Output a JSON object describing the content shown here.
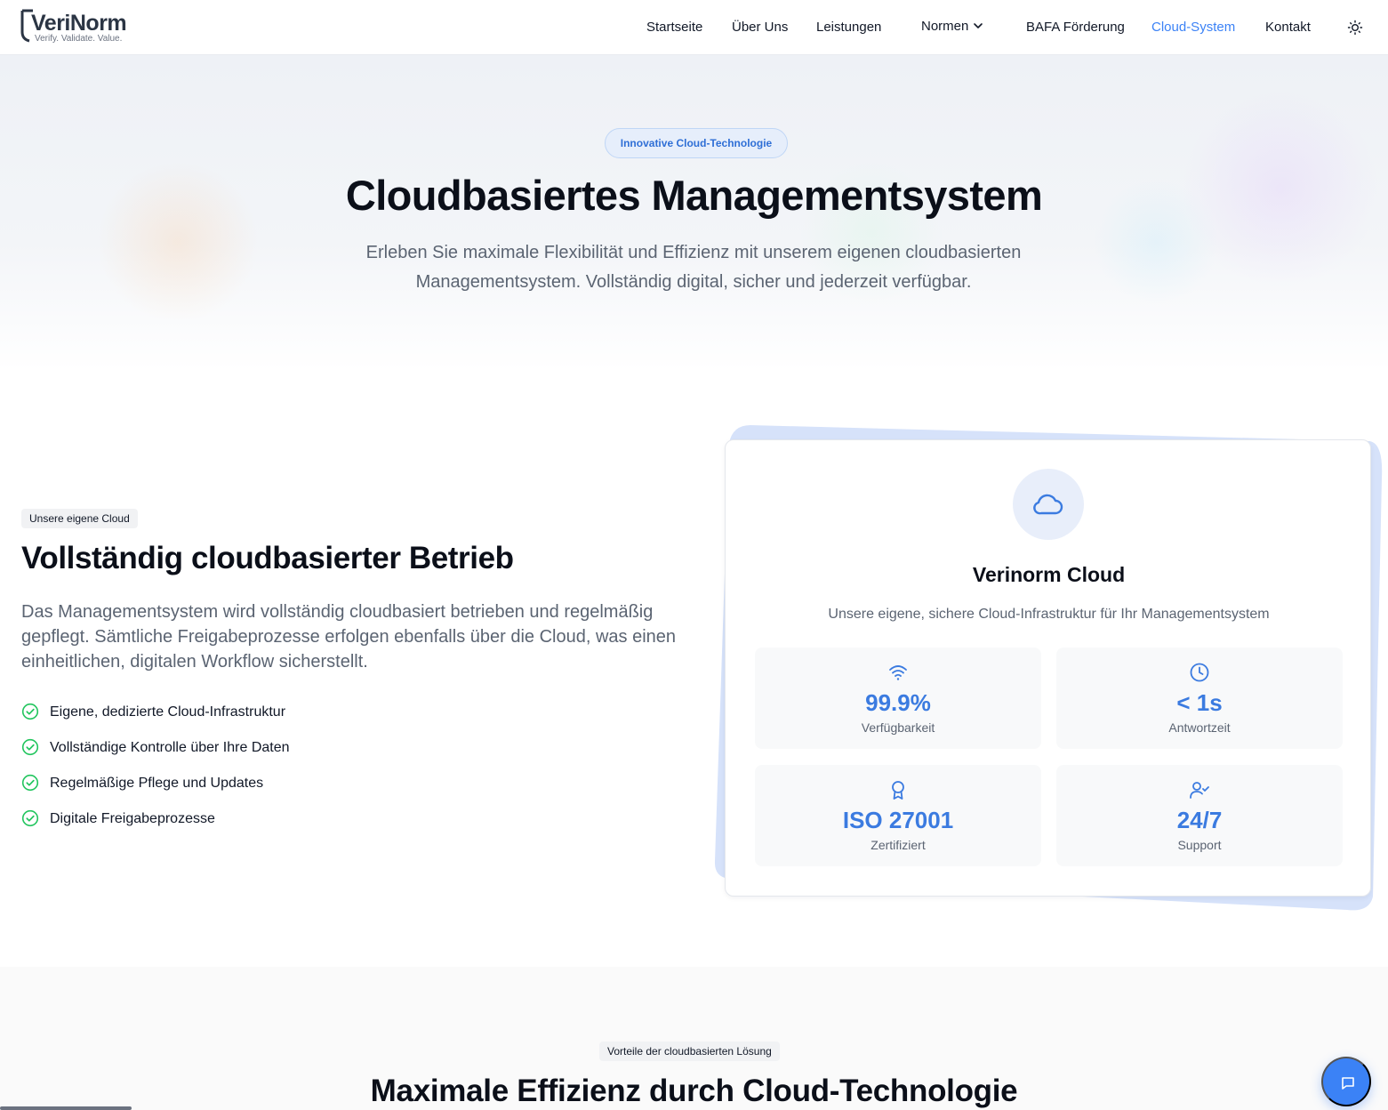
{
  "brand": {
    "name": "VeriNorm",
    "tagline": "Verify. Validate. Value."
  },
  "nav": {
    "items": [
      {
        "label": "Startseite"
      },
      {
        "label": "Über Uns"
      },
      {
        "label": "Leistungen"
      },
      {
        "label": "Normen"
      },
      {
        "label": "BAFA Förderung"
      },
      {
        "label": "Cloud-System",
        "active": true
      },
      {
        "label": "Kontakt"
      }
    ]
  },
  "hero": {
    "pill": "Innovative Cloud-Technologie",
    "title": "Cloudbasiertes Managementsystem",
    "subtitle": "Erleben Sie maximale Flexibilität und Effizienz mit unserem eigenen cloudbasierten Managementsystem. Vollständig digital, sicher und jederzeit verfügbar."
  },
  "feature": {
    "tag": "Unsere eigene Cloud",
    "title": "Vollständig cloudbasierter Betrieb",
    "description": "Das Managementsystem wird vollständig cloudbasiert betrieben und regelmäßig gepflegt. Sämtliche Freigabeprozesse erfolgen ebenfalls über die Cloud, was einen einheitlichen, digitalen Workflow sicherstellt.",
    "checks": [
      "Eigene, dedizierte Cloud-Infrastruktur",
      "Vollständige Kontrolle über Ihre Daten",
      "Regelmäßige Pflege und Updates",
      "Digitale Freigabeprozesse"
    ]
  },
  "card": {
    "icon": "cloud-icon",
    "title": "Verinorm Cloud",
    "subtitle": "Unsere eigene, sichere Cloud-Infrastruktur für Ihr Managementsystem",
    "stats": [
      {
        "icon": "wifi-icon",
        "value": "99.9%",
        "label": "Verfügbarkeit"
      },
      {
        "icon": "clock-icon",
        "value": "< 1s",
        "label": "Antwortzeit"
      },
      {
        "icon": "award-icon",
        "value": "ISO 27001",
        "label": "Zertifiziert"
      },
      {
        "icon": "user-check-icon",
        "value": "24/7",
        "label": "Support"
      }
    ]
  },
  "benefits": {
    "tag": "Vorteile der cloudbasierten Lösung",
    "title": "Maximale Effizienz durch Cloud-Technologie"
  },
  "colors": {
    "accent": "#3b82f6",
    "check": "#22c55e",
    "text": "#0b0f19",
    "muted": "#5b6472"
  }
}
